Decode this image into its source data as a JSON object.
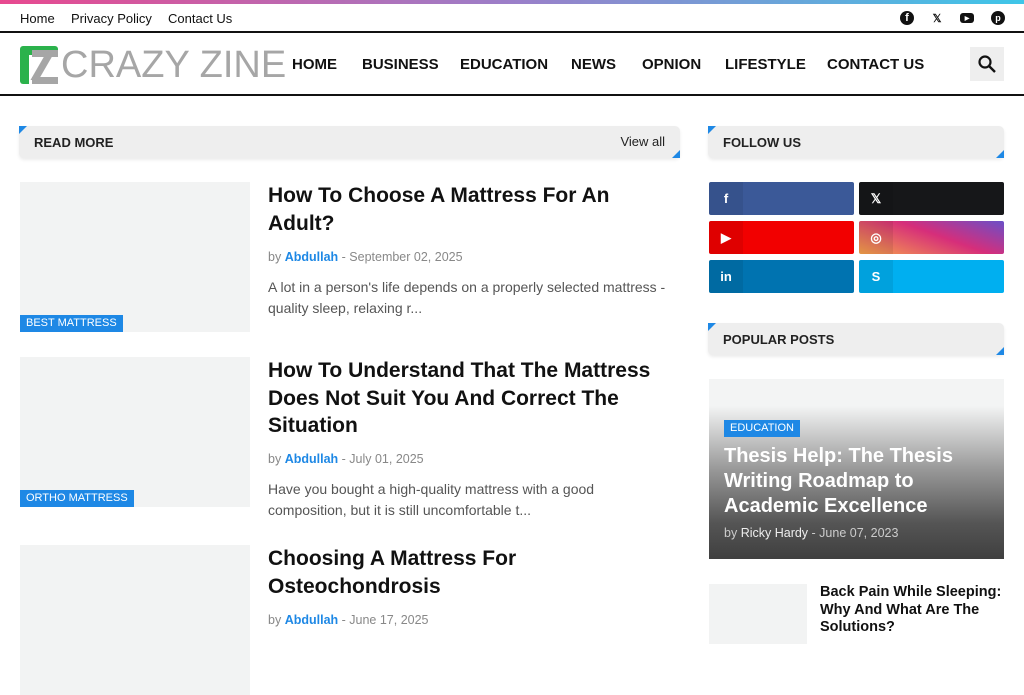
{
  "topbar": {
    "links": [
      "Home",
      "Privacy Policy",
      "Contact Us"
    ],
    "social": [
      "facebook-icon",
      "x-icon",
      "youtube-icon",
      "pinterest-icon"
    ]
  },
  "header": {
    "logo": "CRAZY ZINE",
    "nav": [
      "HOME",
      "BUSINESS",
      "EDUCATION",
      "NEWS",
      "OPNION",
      "LIFESTYLE",
      "CONTACT US"
    ]
  },
  "main": {
    "section_title": "READ MORE",
    "view_all": "View all",
    "articles": [
      {
        "category": "BEST MATTRESS",
        "title": "How To Choose A Mattress For An Adult?",
        "by": "by",
        "author": "Abdullah",
        "date": "- September 02, 2025",
        "excerpt": "A lot in a person's life depends on a properly selected mattress - quality sleep, relaxing r..."
      },
      {
        "category": "ORTHO MATTRESS",
        "title": "How To Understand That The Mattress Does Not Suit You And Correct The Situation",
        "by": "by",
        "author": "Abdullah",
        "date": "- July 01, 2025",
        "excerpt": "Have you bought a high-quality mattress with a good composition, but it is still uncomfortable t..."
      },
      {
        "category": "",
        "title": "Choosing A Mattress For Osteochondrosis",
        "by": "by",
        "author": "Abdullah",
        "date": "- June 17, 2025",
        "excerpt": ""
      }
    ]
  },
  "sidebar": {
    "follow_title": "FOLLOW US",
    "social": [
      {
        "icon": "facebook-icon",
        "glyph": "f",
        "color": "#3b5998"
      },
      {
        "icon": "x-icon",
        "glyph": "𝕏",
        "color": "#161719"
      },
      {
        "icon": "youtube-icon",
        "glyph": "▶",
        "color": "#f20000"
      },
      {
        "icon": "instagram-icon",
        "glyph": "◎",
        "color": "#d62e7a"
      },
      {
        "icon": "linkedin-icon",
        "glyph": "in",
        "color": "#0073b0"
      },
      {
        "icon": "skype-icon",
        "glyph": "S",
        "color": "#00aff0"
      }
    ],
    "popular_title": "POPULAR POSTS",
    "featured": {
      "category": "EDUCATION",
      "title": "Thesis Help: The Thesis Writing Roadmap to Academic Excellence",
      "by": "by",
      "author": "Ricky Hardy",
      "date": "- June 07, 2023"
    },
    "list": [
      {
        "title": "Back Pain While Sleeping: Why And What Are The Solutions?"
      }
    ]
  }
}
